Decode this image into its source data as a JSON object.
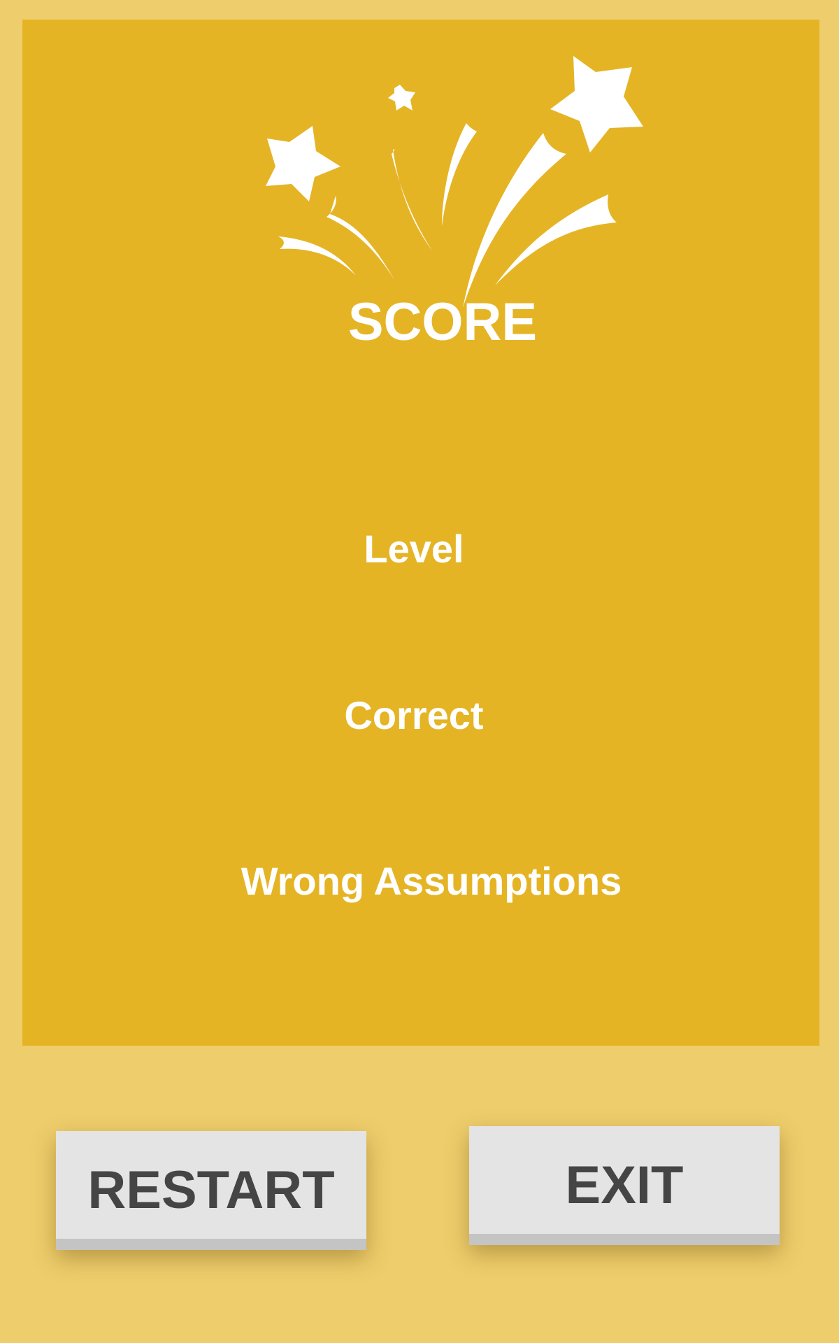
{
  "score_panel": {
    "title": "SCORE",
    "level_label": "Level",
    "correct_label": "Correct",
    "wrong_label": "Wrong Assumptions"
  },
  "buttons": {
    "restart_label": "RESTART",
    "exit_label": "EXIT"
  },
  "icons": {
    "decoration": "fireworks-icon"
  },
  "colors": {
    "background": "#eecd6c",
    "panel": "#e5b425",
    "text": "#ffffff",
    "button_face": "#e4e4e4",
    "button_edge": "#c4c4c4",
    "button_text": "#454545"
  }
}
